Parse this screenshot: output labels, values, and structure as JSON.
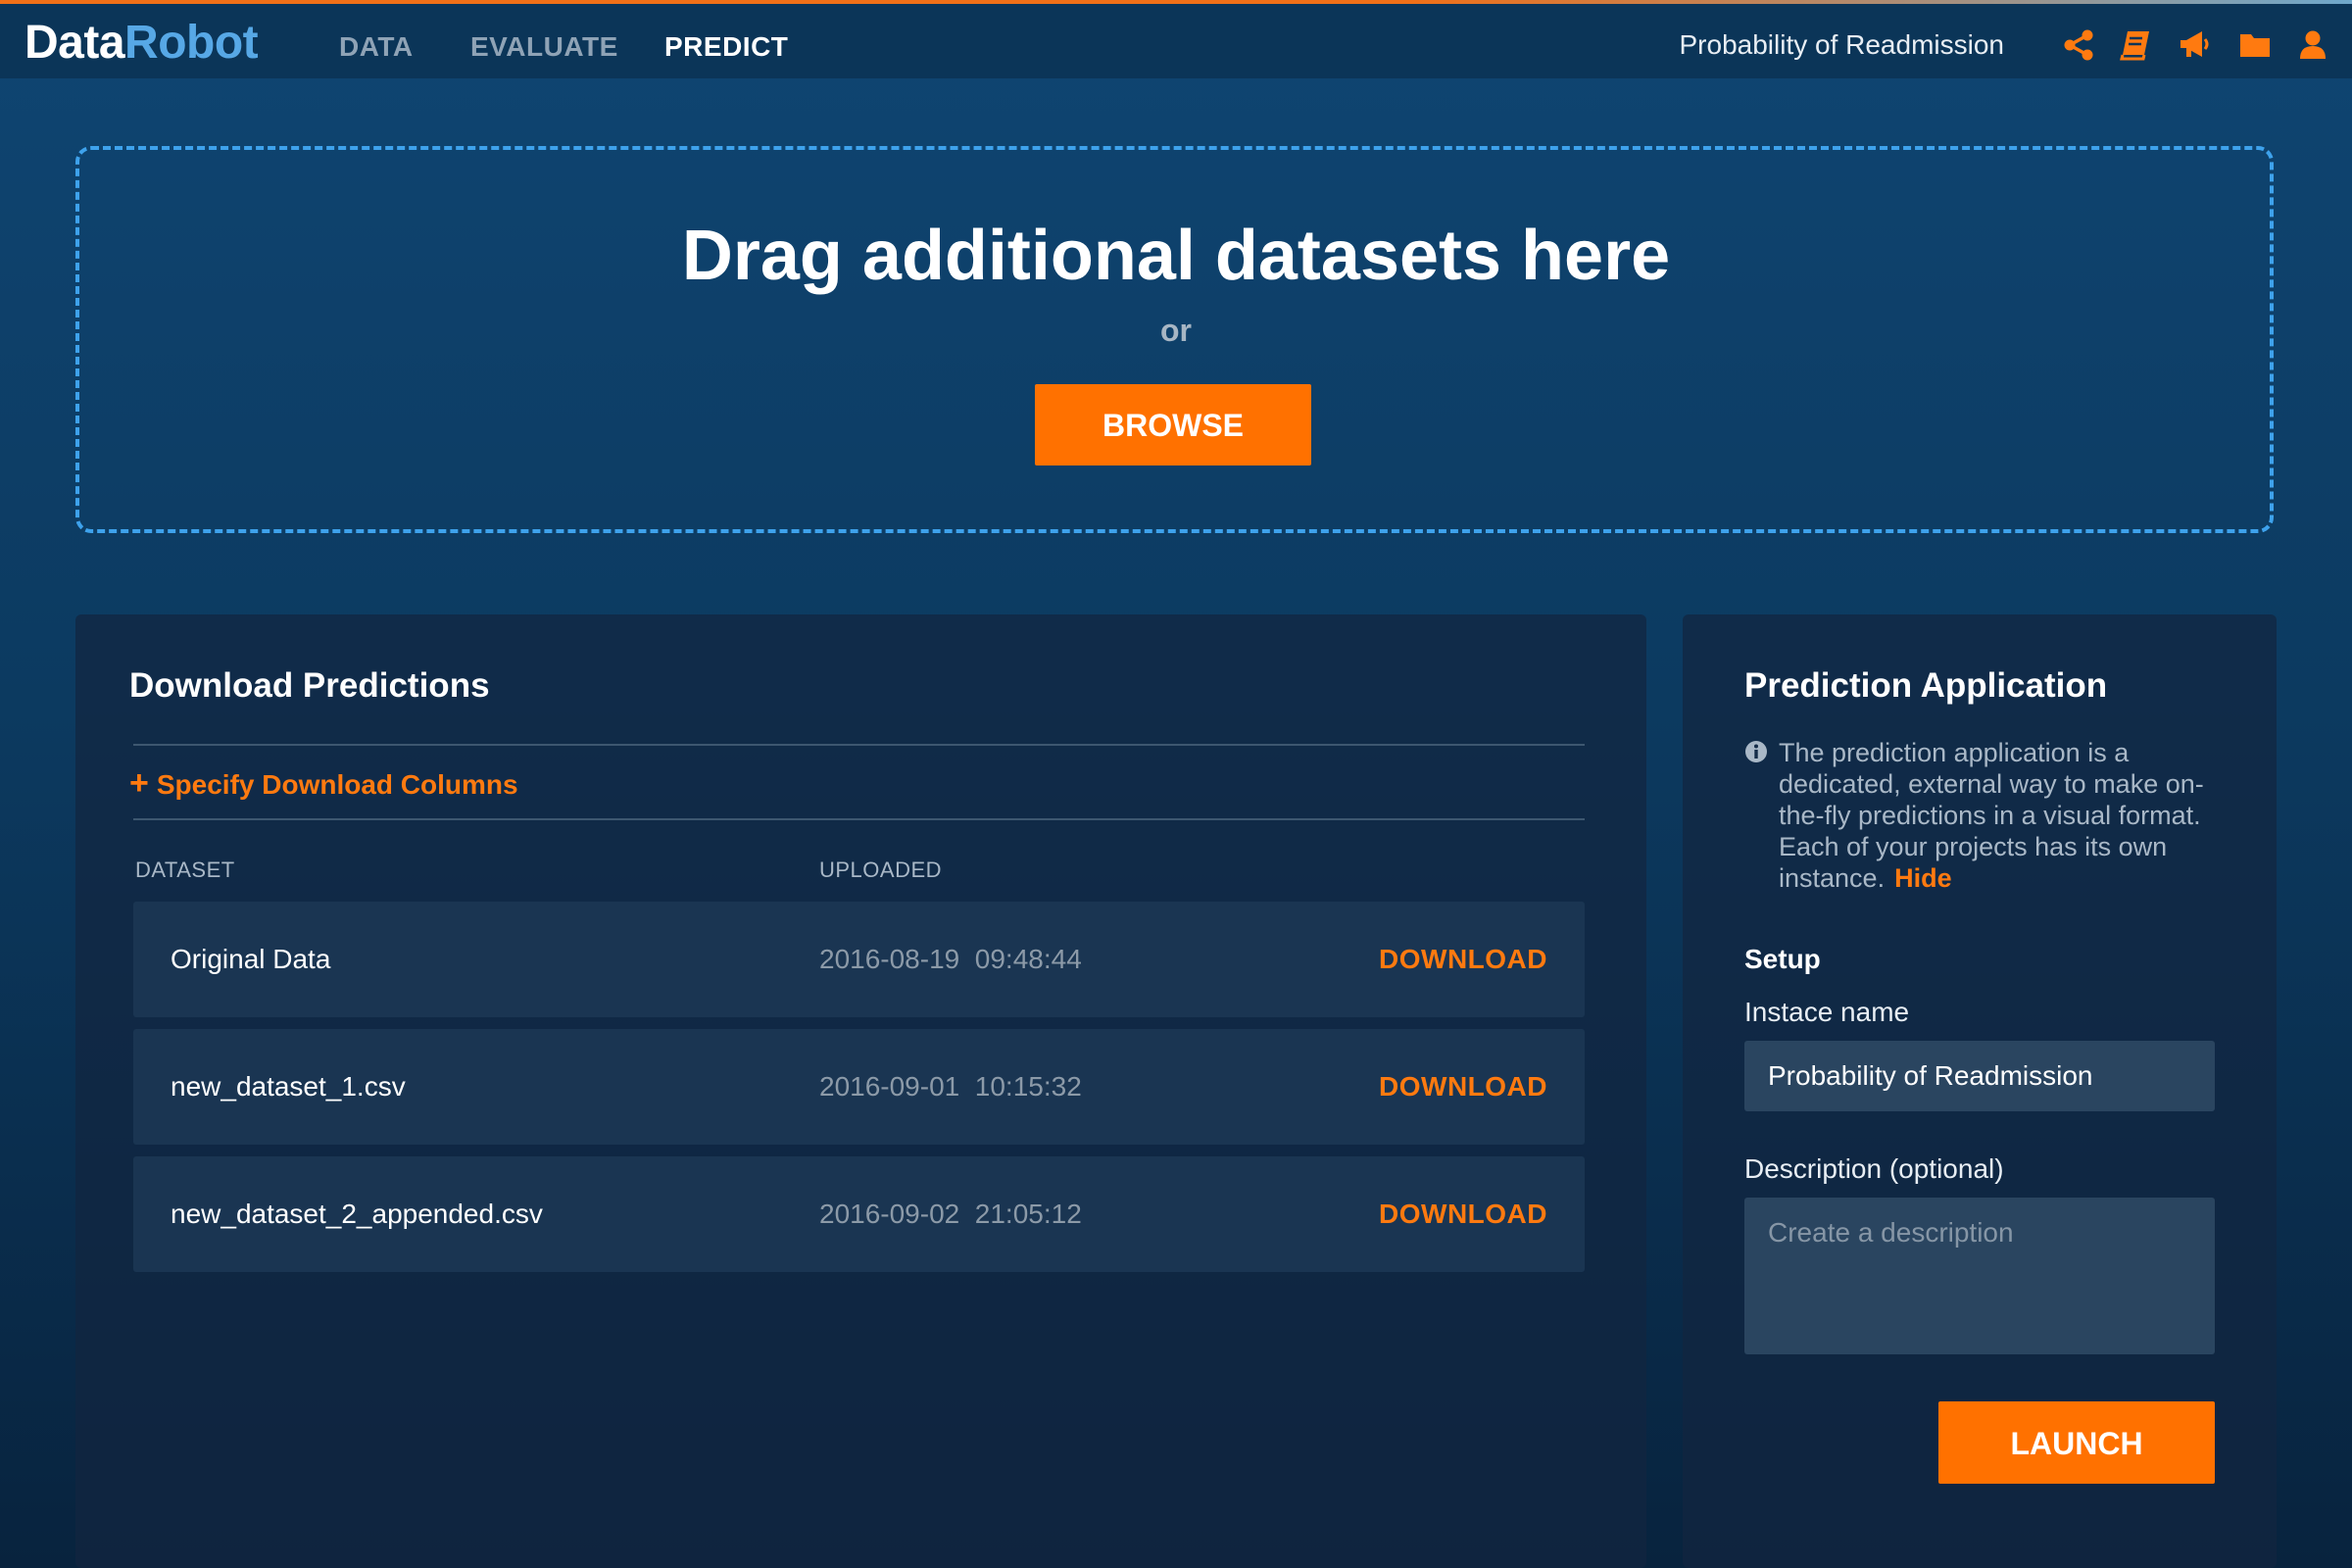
{
  "header": {
    "logo_part1": "Data",
    "logo_part2": "Robot",
    "nav": [
      {
        "label": "DATA",
        "active": false
      },
      {
        "label": "EVALUATE",
        "active": false
      },
      {
        "label": "PREDICT",
        "active": true
      }
    ],
    "project_name": "Probability of Readmission",
    "icons": [
      "share-icon",
      "book-icon",
      "megaphone-icon",
      "folder-icon",
      "user-icon"
    ],
    "icon_color": "#ff7a10"
  },
  "dropzone": {
    "title": "Drag additional datasets here",
    "or": "or",
    "browse_label": "BROWSE"
  },
  "download_predictions": {
    "title": "Download Predictions",
    "specify_columns": "Specify Download Columns",
    "columns": [
      "DATASET",
      "UPLOADED"
    ],
    "rows": [
      {
        "dataset": "Original Data",
        "uploaded": "2016-08-19  09:48:44",
        "action": "DOWNLOAD"
      },
      {
        "dataset": "new_dataset_1.csv",
        "uploaded": "2016-09-01  10:15:32",
        "action": "DOWNLOAD"
      },
      {
        "dataset": "new_dataset_2_appended.csv",
        "uploaded": "2016-09-02  21:05:12",
        "action": "DOWNLOAD"
      }
    ]
  },
  "prediction_application": {
    "title": "Prediction Application",
    "info_text": "The prediction application is a dedicated, external way to make on-the-fly predictions in a visual format. Each of your projects has its own instance.",
    "hide_label": "Hide",
    "setup_label": "Setup",
    "instance_name_label": "Instace name",
    "instance_name_value": "Probability of Readmission",
    "description_label": "Description (optional)",
    "description_placeholder": "Create a description",
    "launch_label": "LAUNCH"
  },
  "colors": {
    "accent": "#ff7100",
    "link_blue": "#3ea2ec",
    "background": "#0c3a60"
  }
}
